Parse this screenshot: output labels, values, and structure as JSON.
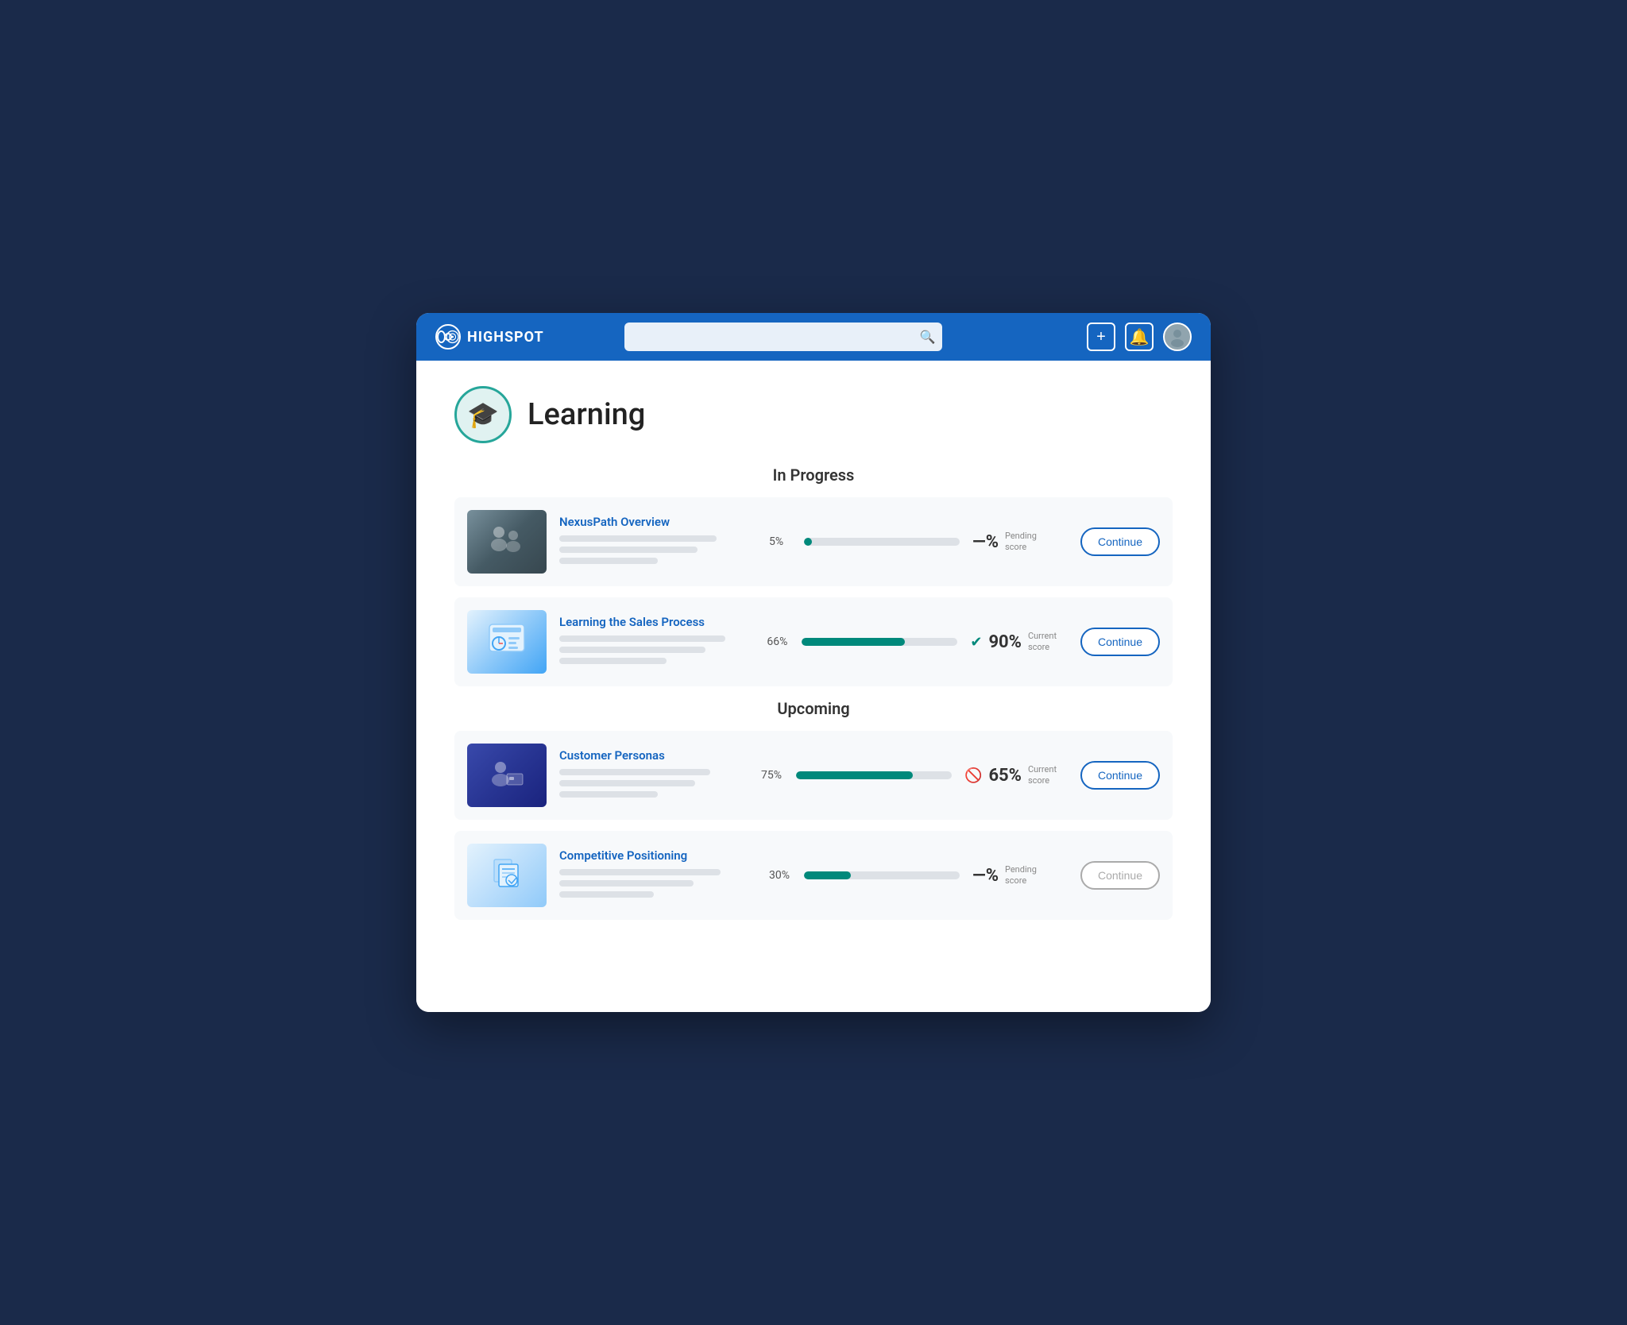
{
  "header": {
    "logo_text": "HIGHSPOT",
    "search_placeholder": "",
    "add_label": "+",
    "notification_label": "🔔"
  },
  "page": {
    "title": "Learning",
    "icon": "🎓"
  },
  "sections": [
    {
      "title": "In Progress",
      "courses": [
        {
          "id": "nexuspath",
          "name": "NexusPath Overview",
          "progress_pct": "5%",
          "progress_value": 5,
          "score_display": "—%",
          "score_label": "Pending score",
          "score_icon": "",
          "score_icon_type": "none",
          "button_label": "Continue",
          "thumb_type": "people"
        },
        {
          "id": "sales-process",
          "name": "Learning the Sales Process",
          "progress_pct": "66%",
          "progress_value": 66,
          "score_display": "90%",
          "score_label": "Current score",
          "score_icon": "✔",
          "score_icon_type": "check",
          "button_label": "Continue",
          "thumb_type": "dashboard"
        }
      ]
    },
    {
      "title": "Upcoming",
      "courses": [
        {
          "id": "customer-personas",
          "name": "Customer Personas",
          "progress_pct": "75%",
          "progress_value": 75,
          "score_display": "65%",
          "score_label": "Current score",
          "score_icon": "🚫",
          "score_icon_type": "block",
          "button_label": "Continue",
          "thumb_type": "business"
        },
        {
          "id": "competitive-positioning",
          "name": "Competitive Positioning",
          "progress_pct": "30%",
          "progress_value": 30,
          "score_display": "—%",
          "score_label": "Pending score",
          "score_icon": "",
          "score_icon_type": "none",
          "button_label": "Continue",
          "thumb_type": "docs"
        }
      ]
    }
  ]
}
